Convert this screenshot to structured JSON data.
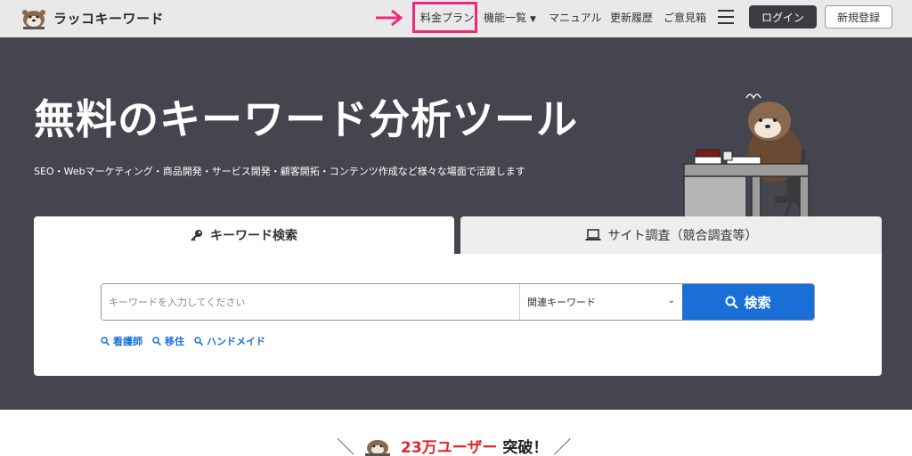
{
  "header": {
    "logo_text": "ラッコキーワード",
    "nav": {
      "pricing": "料金プラン",
      "features": "機能一覧",
      "manual": "マニュアル",
      "history": "更新履歴",
      "feedback": "ご意見箱"
    },
    "login": "ログイン",
    "register": "新規登録"
  },
  "hero": {
    "title": "無料のキーワード分析ツール",
    "subtitle": "SEO・Webマーケティング・商品開発・サービス開発・顧客開拓・コンテンツ作成など様々な場面で活躍します"
  },
  "tabs": {
    "keyword": "キーワード検索",
    "site": "サイト調査（競合調査等）"
  },
  "search": {
    "placeholder": "キーワードを入力してください",
    "select_value": "関連キーワード",
    "button": "検索",
    "suggestions": [
      "看護師",
      "移住",
      "ハンドメイド"
    ]
  },
  "users": {
    "count": "23万ユーザー",
    "suffix": "突破！"
  },
  "colors": {
    "accent": "#1a6fd6",
    "highlight": "#ec2a7b",
    "hero_bg": "#45454f",
    "red": "#e0262c"
  }
}
